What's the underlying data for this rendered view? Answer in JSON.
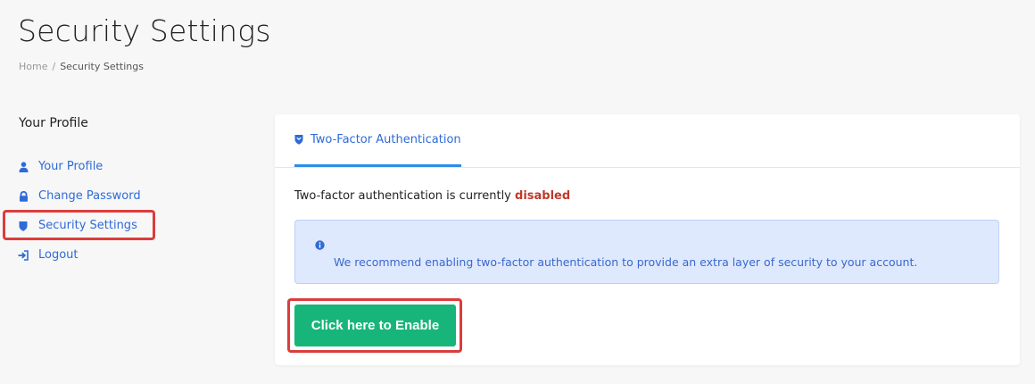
{
  "header": {
    "title": "Security Settings",
    "breadcrumb": [
      "Home",
      "/",
      "Security Settings"
    ]
  },
  "sidebar": {
    "heading": "Your Profile",
    "items": [
      {
        "label": "Your Profile",
        "icon": "user-icon"
      },
      {
        "label": "Change Password",
        "icon": "lock-icon"
      },
      {
        "label": "Security Settings",
        "icon": "shield-icon",
        "active": true
      },
      {
        "label": "Logout",
        "icon": "logout-icon"
      }
    ]
  },
  "main": {
    "tab": {
      "label": "Two-Factor Authentication",
      "icon": "shield-icon"
    },
    "status_prefix": "Two-factor authentication is currently ",
    "status_value": "disabled",
    "alert_text": "We recommend enabling two-factor authentication to provide an extra layer of security to your account.",
    "alert_icon": "info-icon",
    "enable_button_label": "Click here to Enable"
  },
  "colors": {
    "accent": "#2e6bd8",
    "tab_underline": "#2d8ce8",
    "status_disabled": "#c0392b",
    "alert_bg": "#dfe9fe",
    "button_bg": "#18b57a",
    "highlight": "#dc3c3c"
  }
}
